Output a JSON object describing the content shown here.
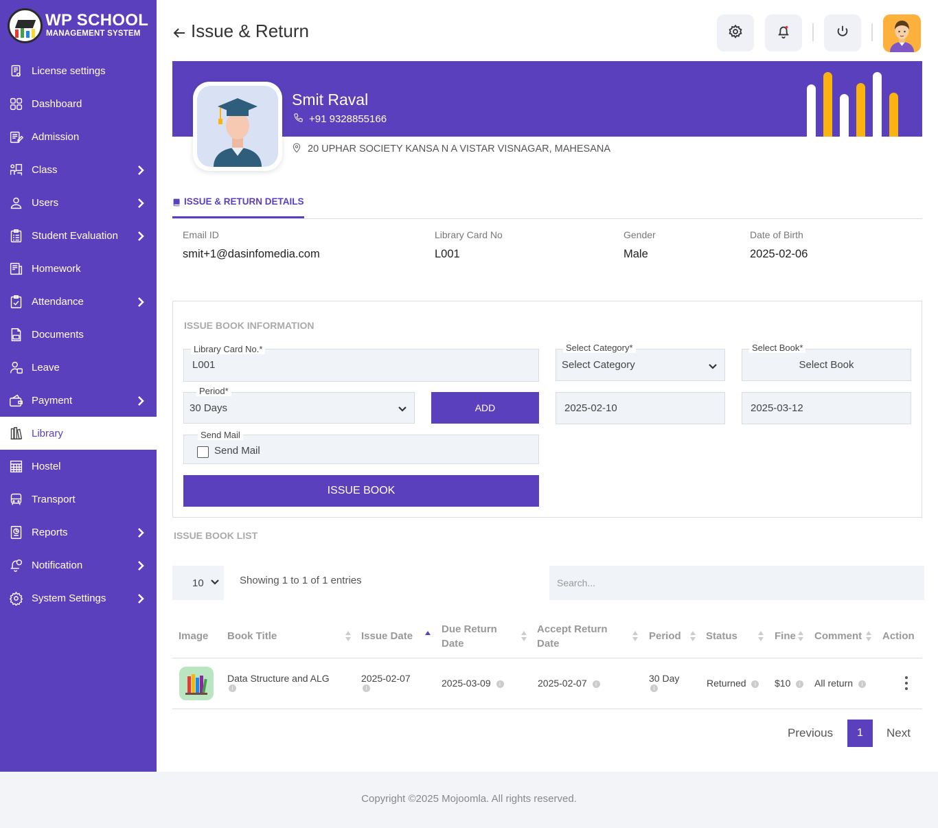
{
  "brand": {
    "title": "WP SCHOOL",
    "subtitle": "MANAGEMENT SYSTEM"
  },
  "sidebar": {
    "items": [
      {
        "label": "License settings",
        "icon": "license-icon",
        "has_submenu": false,
        "active": false
      },
      {
        "label": "Dashboard",
        "icon": "dashboard-icon",
        "has_submenu": false,
        "active": false
      },
      {
        "label": "Admission",
        "icon": "admission-icon",
        "has_submenu": false,
        "active": false
      },
      {
        "label": "Class",
        "icon": "class-icon",
        "has_submenu": true,
        "active": false
      },
      {
        "label": "Users",
        "icon": "users-icon",
        "has_submenu": true,
        "active": false
      },
      {
        "label": "Student Evaluation",
        "icon": "evaluation-icon",
        "has_submenu": true,
        "active": false
      },
      {
        "label": "Homework",
        "icon": "homework-icon",
        "has_submenu": false,
        "active": false
      },
      {
        "label": "Attendance",
        "icon": "attendance-icon",
        "has_submenu": true,
        "active": false
      },
      {
        "label": "Documents",
        "icon": "documents-icon",
        "has_submenu": false,
        "active": false
      },
      {
        "label": "Leave",
        "icon": "leave-icon",
        "has_submenu": false,
        "active": false
      },
      {
        "label": "Payment",
        "icon": "payment-icon",
        "has_submenu": true,
        "active": false
      },
      {
        "label": "Library",
        "icon": "library-icon",
        "has_submenu": false,
        "active": true
      },
      {
        "label": "Hostel",
        "icon": "hostel-icon",
        "has_submenu": false,
        "active": false
      },
      {
        "label": "Transport",
        "icon": "transport-icon",
        "has_submenu": false,
        "active": false
      },
      {
        "label": "Reports",
        "icon": "reports-icon",
        "has_submenu": true,
        "active": false
      },
      {
        "label": "Notification",
        "icon": "notification-icon",
        "has_submenu": true,
        "active": false
      },
      {
        "label": "System Settings",
        "icon": "system-settings-icon",
        "has_submenu": true,
        "active": false
      }
    ]
  },
  "header": {
    "title": "Issue & Return"
  },
  "profile": {
    "name": "Smit Raval",
    "phone": "+91  9328855166",
    "address": "20 UPHAR SOCIETY KANSA N A VISTAR VISNAGAR, MAHESANA"
  },
  "tabs": {
    "details_label": "ISSUE & RETURN DETAILS"
  },
  "details": {
    "email_label": "Email ID",
    "email_value": "smit+1@dasinfomedia.com",
    "card_label": "Library Card No",
    "card_value": "L001",
    "gender_label": "Gender",
    "gender_value": "Male",
    "dob_label": "Date of Birth",
    "dob_value": "2025-02-06"
  },
  "issue_form": {
    "section_title": "ISSUE BOOK INFORMATION",
    "card_no_label": "Library Card No.*",
    "card_no_value": "L001",
    "category_label": "Select Category*",
    "category_value": "Select Category",
    "book_label": "Select Book*",
    "book_value": "Select Book",
    "period_label": "Period*",
    "period_value": "30 Days",
    "add_label": "ADD",
    "issue_date_value": "2025-02-10",
    "return_date_value": "2025-03-12",
    "send_mail_label": "Send Mail",
    "send_mail_text": "Send Mail",
    "issue_button": "ISSUE BOOK"
  },
  "list": {
    "title": "ISSUE BOOK LIST",
    "page_length": "10",
    "entries_info": "Showing 1 to 1 of 1 entries",
    "search_placeholder": "Search...",
    "columns": [
      "Image",
      "Book Title",
      "Issue Date",
      "Due Return Date",
      "Accept Return Date",
      "Period",
      "Status",
      "Fine",
      "Comment",
      "Action"
    ],
    "rows": [
      {
        "book_title": "Data Structure and ALG",
        "issue_date": "2025-02-07",
        "due_return_date": "2025-03-09",
        "accept_return_date": "2025-02-07",
        "period": "30 Day",
        "status": "Returned",
        "fine": "$10",
        "comment": "All return"
      }
    ]
  },
  "pagination": {
    "previous": "Previous",
    "current": "1",
    "next": "Next"
  },
  "footer": {
    "copyright": "Copyright ©2025 Mojoomla. All rights reserved."
  },
  "colors": {
    "primary": "#5b40bd",
    "accent_bar": "#fbb40f",
    "avatar_bg": "#fbb13c"
  }
}
